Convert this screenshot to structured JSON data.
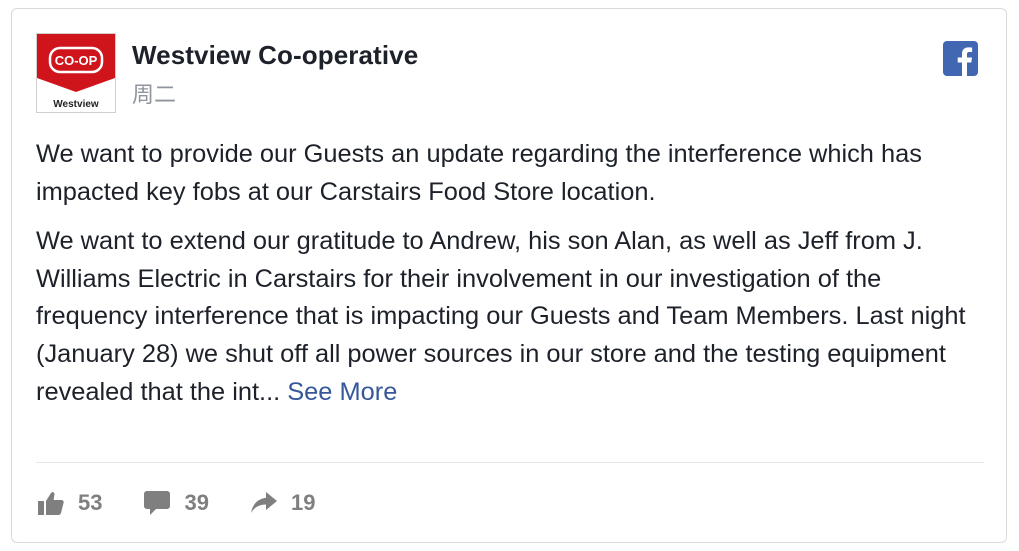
{
  "post": {
    "page_name": "Westview Co-operative",
    "timestamp": "周二",
    "avatar": {
      "badge_text": "CO-OP",
      "caption": "Westview",
      "brand_red": "#d0141c"
    },
    "social_icon": "facebook-icon",
    "paragraphs": [
      "We want to provide our Guests an update regarding the interference which has impacted key fobs at our Carstairs Food Store location.",
      "We want to extend our gratitude to Andrew, his son Alan, as well as Jeff from J. Williams Electric in Carstairs for their involvement in our investigation of the frequency interference that is impacting our Guests and Team Members. Last night (January 28) we shut off all power sources in our store and the testing equipment revealed that the int..."
    ],
    "see_more_label": "See More"
  },
  "stats": {
    "likes": "53",
    "comments": "39",
    "shares": "19"
  },
  "colors": {
    "facebook_blue": "#4267b2",
    "link_blue": "#365899",
    "icon_gray": "#7f7f7f"
  }
}
